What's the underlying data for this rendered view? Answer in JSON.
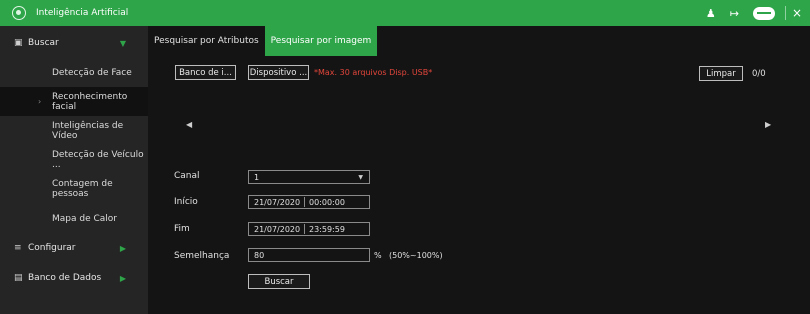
{
  "app": {
    "title": "Inteligência Artificial"
  },
  "titlebar": {
    "user_icon": "user-settings-icon",
    "logout_icon": "logout-icon",
    "cloud_label": "Cloud",
    "close_glyph": "×"
  },
  "sidebar": {
    "buscar": {
      "label": "Buscar",
      "icon": "search-folder-icon"
    },
    "sub_items": [
      {
        "label": "Detecção de Face"
      },
      {
        "label": "Reconhecimento facial",
        "active": true
      },
      {
        "label": "Inteligências de Vídeo"
      },
      {
        "label": "Detecção de Veículo ..."
      },
      {
        "label": "Contagem de pessoas"
      },
      {
        "label": "Mapa de Calor"
      }
    ],
    "configurar": {
      "label": "Configurar",
      "icon": "list-icon"
    },
    "banco": {
      "label": "Banco de Dados",
      "icon": "database-icon"
    }
  },
  "tabs": [
    {
      "label": "Pesquisar por Atributos"
    },
    {
      "label": "Pesquisar por imagem",
      "active": true
    }
  ],
  "toolbar": {
    "banco_btn": "Banco de i...",
    "dispositivo_btn": "Dispositivo ...",
    "note": "*Max. 30 arquivos Disp. USB*",
    "limpar_btn": "Limpar",
    "count": "0/0"
  },
  "form": {
    "canal_label": "Canal",
    "canal_value": "1",
    "inicio_label": "Início",
    "inicio_date": "21/07/2020",
    "inicio_time": "00:00:00",
    "fim_label": "Fim",
    "fim_date": "21/07/2020",
    "fim_time": "23:59:59",
    "semelhanca_label": "Semelhança",
    "semelhanca_value": "80",
    "semelhanca_unit": "%",
    "semelhanca_range": "(50%~100%)",
    "buscar_btn": "Buscar"
  },
  "colors": {
    "accent": "#2fa54a",
    "warning": "#e2463b",
    "sidebar_bg": "#252525",
    "main_bg": "#141414"
  }
}
